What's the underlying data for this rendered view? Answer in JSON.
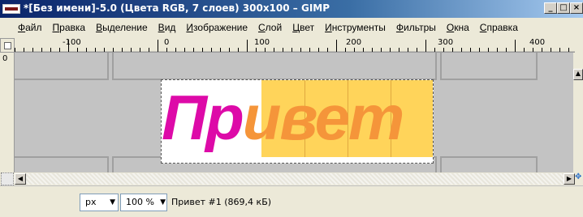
{
  "window": {
    "title": "*[Без имени]-5.0 (Цвета RGB, 7 слоев) 300x100 – GIMP",
    "buttons": {
      "minimize": "_",
      "maximize": "□",
      "close": "×"
    }
  },
  "menu": [
    {
      "label": "Файл",
      "mnemonic": "Ф",
      "rest": "айл"
    },
    {
      "label": "Правка",
      "mnemonic": "П",
      "rest": "равка"
    },
    {
      "label": "Выделение",
      "mnemonic": "В",
      "rest": "ыделение"
    },
    {
      "label": "Вид",
      "mnemonic": "В",
      "rest": "ид"
    },
    {
      "label": "Изображение",
      "mnemonic": "И",
      "rest": "зображение"
    },
    {
      "label": "Слой",
      "mnemonic": "С",
      "rest": "лой"
    },
    {
      "label": "Цвет",
      "mnemonic": "Ц",
      "rest": "вет"
    },
    {
      "label": "Инструменты",
      "mnemonic": "И",
      "rest": "нструменты"
    },
    {
      "label": "Фильтры",
      "mnemonic": "Ф",
      "rest": "ильтры"
    },
    {
      "label": "Окна",
      "mnemonic": "О",
      "rest": "кна"
    },
    {
      "label": "Справка",
      "mnemonic": "С",
      "rest": "правка"
    }
  ],
  "rulers": {
    "horizontal_labels": [
      "-100",
      "0",
      "100",
      "200",
      "300",
      "400"
    ],
    "vertical_labels": [
      "0"
    ]
  },
  "canvas": {
    "text_part1": "Пр",
    "text_part2": "ивет",
    "colors": {
      "magenta": "#dd0aa8",
      "orange": "#f5953a",
      "yellow": "#ffd45a"
    }
  },
  "status": {
    "unit": "px",
    "zoom": "100 %",
    "info": "Привет #1 (869,4 кБ)"
  },
  "icons": {
    "app": "gimp-app-icon",
    "navigate": "navigate-icon",
    "resize": "resize-icon"
  }
}
